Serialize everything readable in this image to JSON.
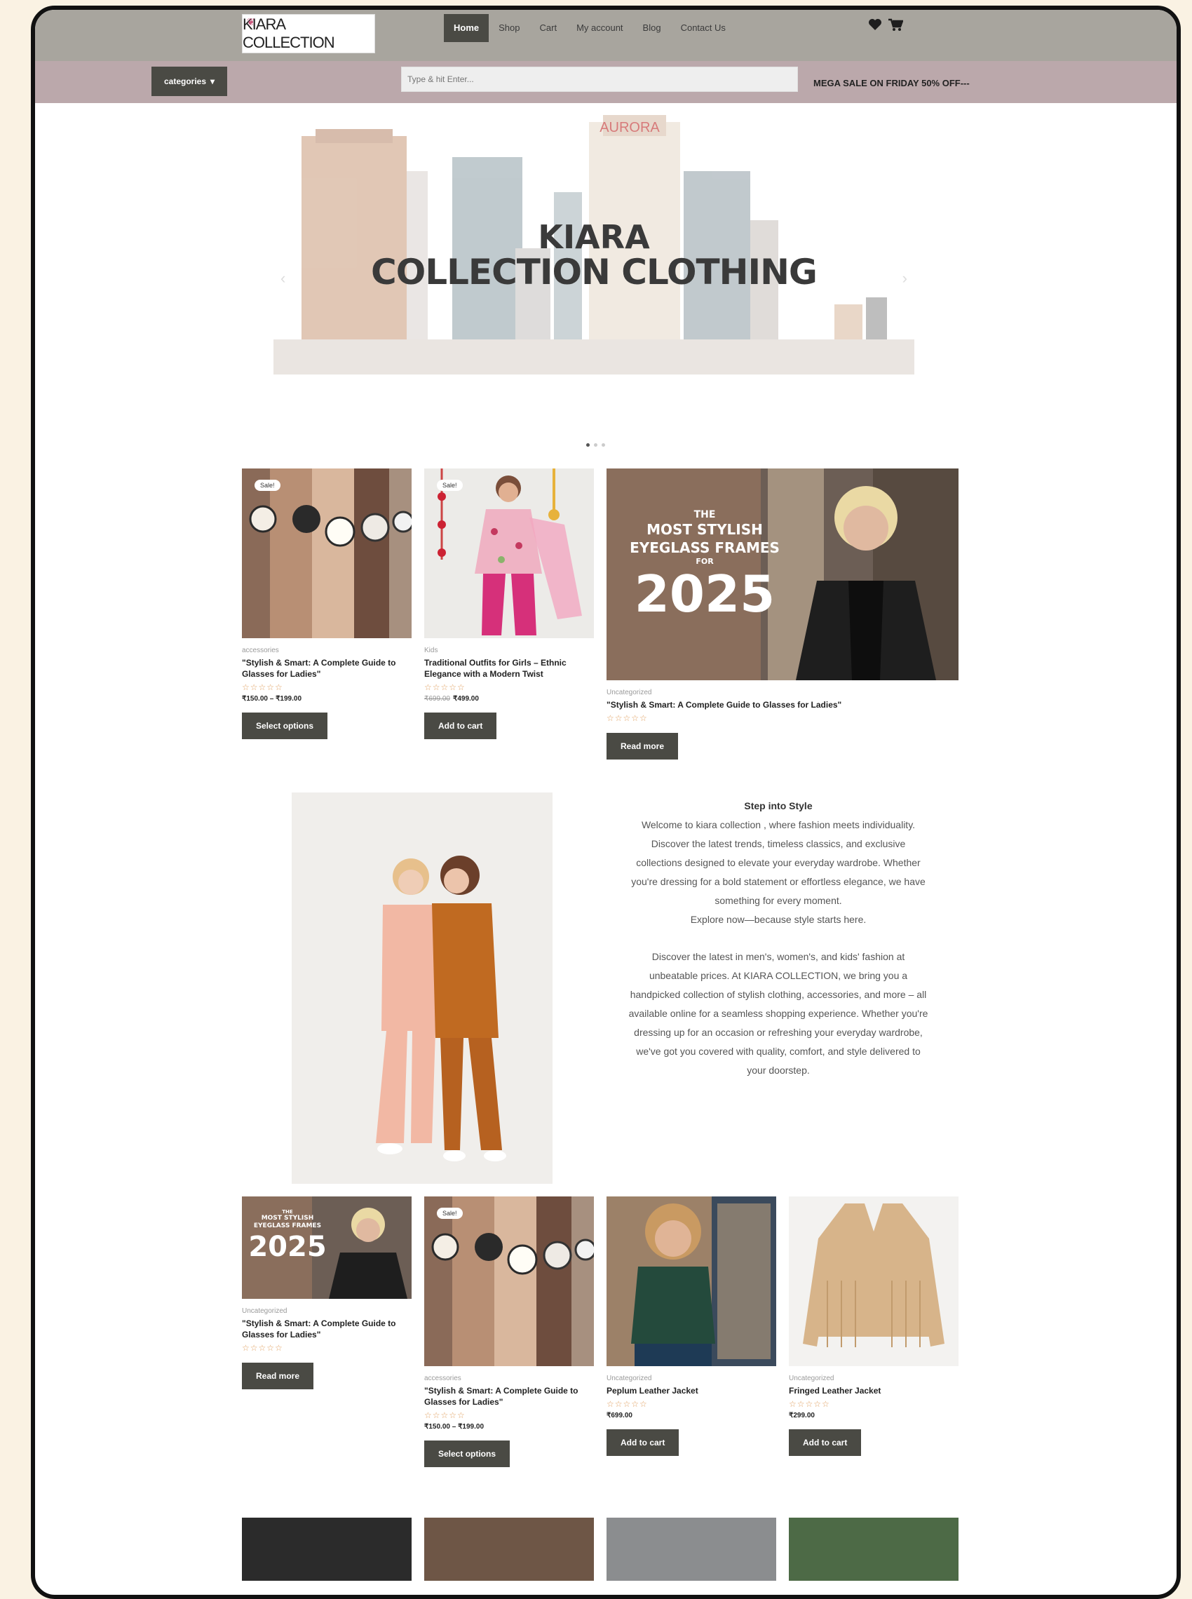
{
  "header": {
    "logo_text": "KIARA COLLECTION",
    "nav": [
      "Home",
      "Shop",
      "Cart",
      "My account",
      "Blog",
      "Contact Us"
    ],
    "active_nav": "Home"
  },
  "subbar": {
    "categories_label": "categories",
    "search_placeholder": "Type & hit Enter...",
    "promo": "MEGA SALE ON FRIDAY 50% OFF---"
  },
  "hero": {
    "line1": "KIARA",
    "line2": "COLLECTION CLOTHING"
  },
  "featured": [
    {
      "category": "accessories",
      "name": "\"Stylish & Smart: A Complete Guide to Glasses for Ladies\"",
      "stars": "☆☆☆☆☆",
      "price": "₹150.00 – ₹199.00",
      "badge": "Sale!",
      "button": "Select options"
    },
    {
      "category": "Kids",
      "name": "Traditional Outfits for Girls – Ethnic Elegance with a Modern Twist",
      "stars": "☆☆☆☆☆",
      "price_old": "₹699.00",
      "price": "₹499.00",
      "badge": "Sale!",
      "button": "Add to cart"
    },
    {
      "category": "Uncategorized",
      "name": "\"Stylish & Smart: A Complete Guide to Glasses for Ladies\"",
      "stars": "☆☆☆☆☆",
      "button": "Read more",
      "promo_the": "THE",
      "promo_line": "MOST STYLISH EYEGLASS FRAMES",
      "promo_for": "FOR",
      "promo_year": "2025"
    }
  ],
  "about": {
    "heading": "Step into Style",
    "lines": [
      "Welcome to kiara collection , where fashion meets individuality.",
      "Discover the latest trends, timeless classics, and exclusive",
      "collections designed to elevate your everyday wardrobe. Whether",
      "you're dressing for a bold statement or effortless elegance, we have",
      "something for every moment.",
      "Explore now—because style starts here."
    ],
    "lines2": [
      "Discover the latest in men's, women's, and kids' fashion at",
      "unbeatable prices. At KIARA COLLECTION, we bring you a",
      "handpicked collection of stylish clothing, accessories, and more – all",
      "available online for a seamless shopping experience. Whether you're",
      "dressing up for an occasion or refreshing your everyday wardrobe,",
      "we've got you covered with quality, comfort, and style delivered to",
      "your doorstep."
    ]
  },
  "products": [
    {
      "category": "Uncategorized",
      "name": "\"Stylish & Smart: A Complete Guide to Glasses for Ladies\"",
      "stars": "☆☆☆☆☆",
      "button": "Read more",
      "promo_the": "THE",
      "promo_line": "MOST STYLISH EYEGLASS FRAMES",
      "promo_year": "2025"
    },
    {
      "category": "accessories",
      "name": "\"Stylish & Smart: A Complete Guide to Glasses for Ladies\"",
      "stars": "☆☆☆☆☆",
      "price": "₹150.00 – ₹199.00",
      "badge": "Sale!",
      "button": "Select options"
    },
    {
      "category": "Uncategorized",
      "name": "Peplum Leather Jacket",
      "stars": "☆☆☆☆☆",
      "price": "₹699.00",
      "button": "Add to cart"
    },
    {
      "category": "Uncategorized",
      "name": "Fringed Leather Jacket",
      "stars": "☆☆☆☆☆",
      "price": "₹299.00",
      "button": "Add to cart"
    }
  ]
}
